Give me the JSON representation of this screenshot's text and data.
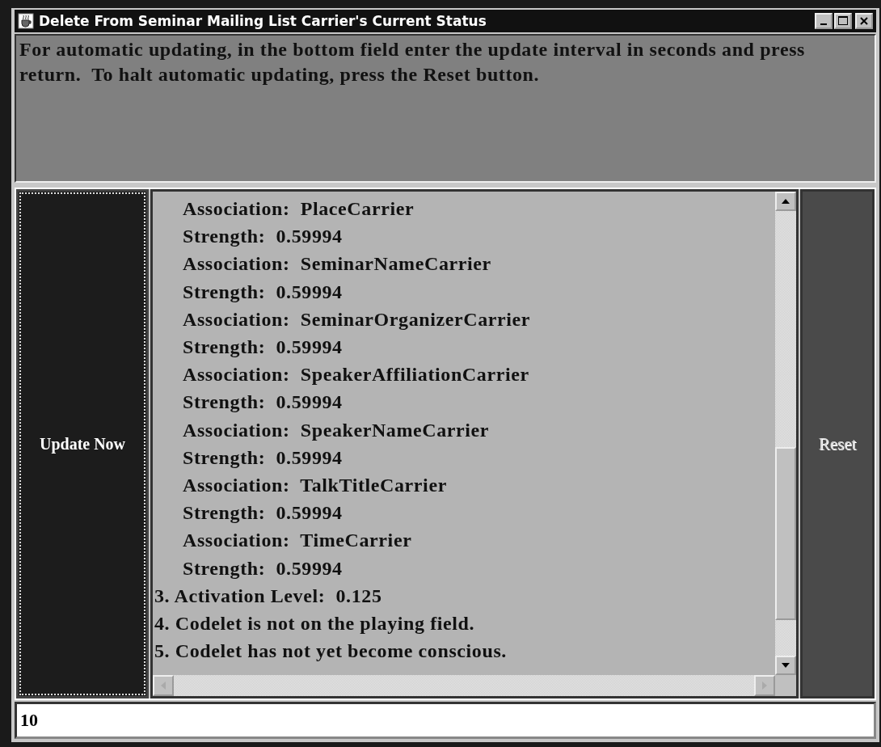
{
  "window": {
    "title": "Delete From Seminar Mailing List Carrier's Current Status"
  },
  "instructions": "For automatic updating, in the bottom field enter the update interval in seconds and press return.  To halt automatic updating, press the Reset button.",
  "update_button": {
    "label": "Update Now",
    "focused": true
  },
  "status_lines": [
    {
      "text": "Association:  PlaceCarrier",
      "indented": true
    },
    {
      "text": "Strength:  0.59994",
      "indented": true
    },
    {
      "text": "Association:  SeminarNameCarrier",
      "indented": true
    },
    {
      "text": "Strength:  0.59994",
      "indented": true
    },
    {
      "text": "Association:  SeminarOrganizerCarrier",
      "indented": true
    },
    {
      "text": "Strength:  0.59994",
      "indented": true
    },
    {
      "text": "Association:  SpeakerAffiliationCarrier",
      "indented": true
    },
    {
      "text": "Strength:  0.59994",
      "indented": true
    },
    {
      "text": "Association:  SpeakerNameCarrier",
      "indented": true
    },
    {
      "text": "Strength:  0.59994",
      "indented": true
    },
    {
      "text": "Association:  TalkTitleCarrier",
      "indented": true
    },
    {
      "text": "Strength:  0.59994",
      "indented": true
    },
    {
      "text": "Association:  TimeCarrier",
      "indented": true
    },
    {
      "text": "Strength:  0.59994",
      "indented": true
    },
    {
      "text": "3. Activation Level:  0.125",
      "indented": false
    },
    {
      "text": "4. Codelet is not on the playing field.",
      "indented": false
    },
    {
      "text": "5. Codelet has not yet become conscious.",
      "indented": false
    }
  ],
  "reset_button": {
    "label": "Reset",
    "disabled": true
  },
  "interval_field": {
    "value": "10"
  }
}
